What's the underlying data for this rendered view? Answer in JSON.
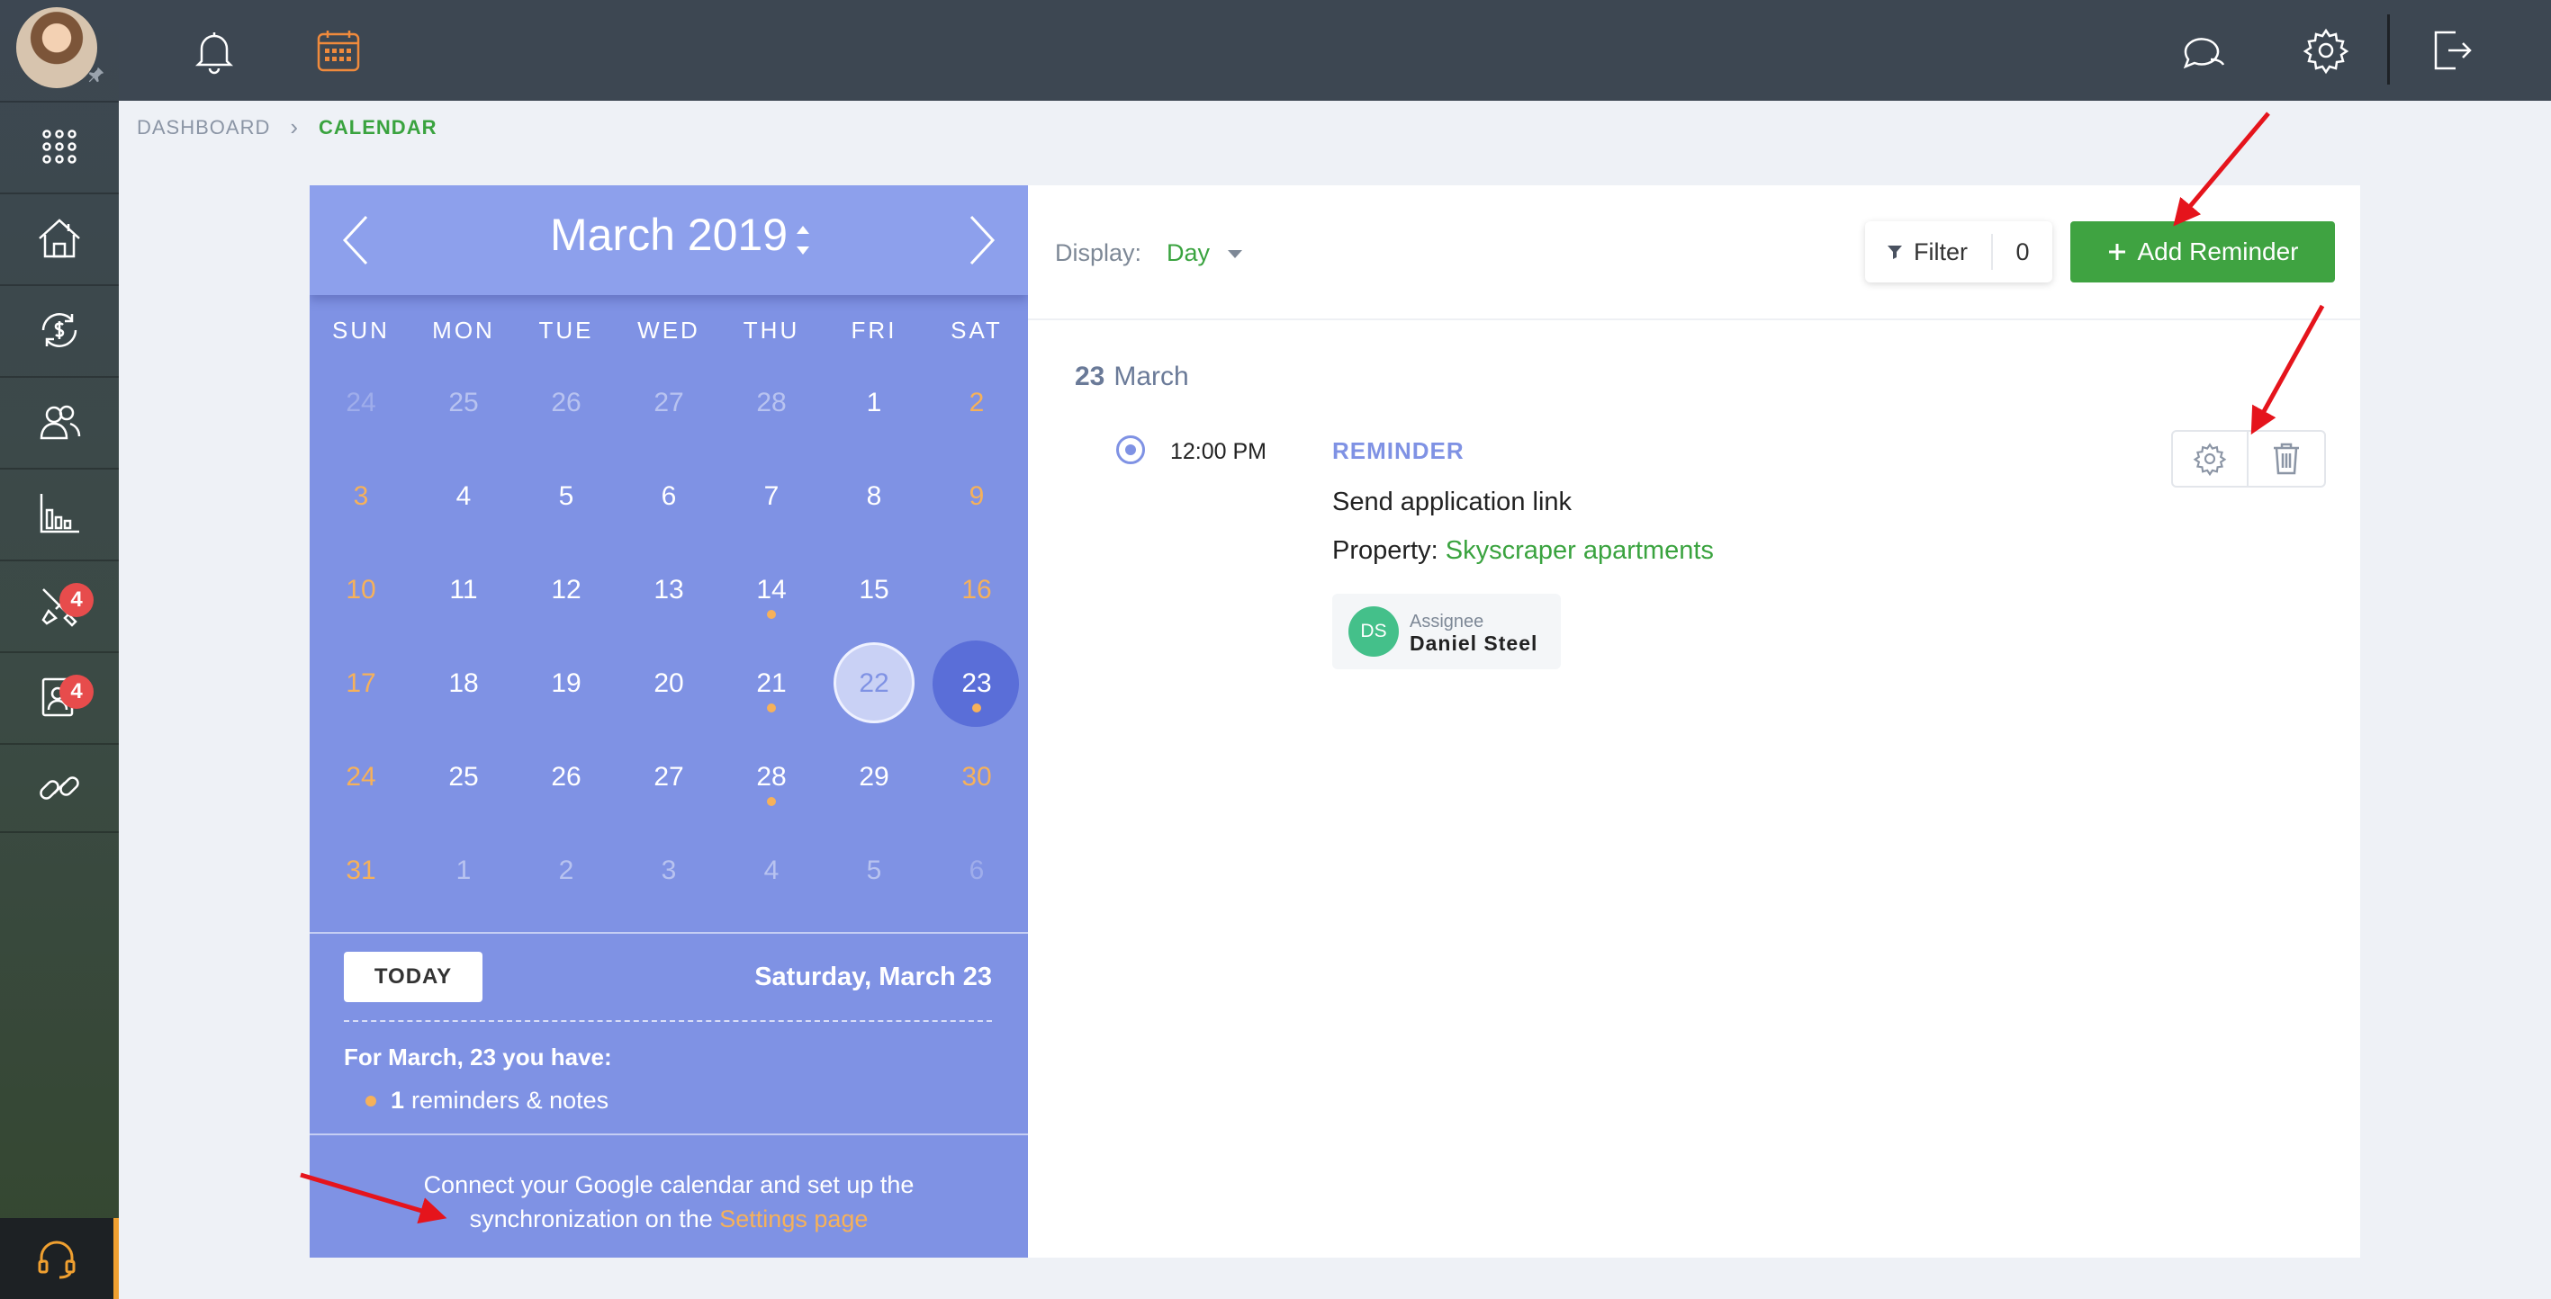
{
  "breadcrumb": {
    "home": "DASHBOARD",
    "separator": "›",
    "current": "CALENDAR"
  },
  "sidebar": {
    "items": [
      {
        "icon": "apps-grid-icon"
      },
      {
        "icon": "properties-icon"
      },
      {
        "icon": "payments-icon"
      },
      {
        "icon": "tenants-icon"
      },
      {
        "icon": "reports-icon"
      },
      {
        "icon": "maintenance-icon",
        "badge": "4"
      },
      {
        "icon": "applicants-icon",
        "badge": "4"
      },
      {
        "icon": "links-icon"
      }
    ]
  },
  "calendar": {
    "title": "March 2019",
    "weekdays": [
      "SUN",
      "MON",
      "TUE",
      "WED",
      "THU",
      "FRI",
      "SAT"
    ],
    "days": [
      {
        "n": "24",
        "m": "very-muted"
      },
      {
        "n": "25",
        "m": "muted"
      },
      {
        "n": "26",
        "m": "muted"
      },
      {
        "n": "27",
        "m": "muted"
      },
      {
        "n": "28",
        "m": "muted"
      },
      {
        "n": "1"
      },
      {
        "n": "2",
        "w": true
      },
      {
        "n": "3",
        "w": true
      },
      {
        "n": "4"
      },
      {
        "n": "5"
      },
      {
        "n": "6"
      },
      {
        "n": "7"
      },
      {
        "n": "8"
      },
      {
        "n": "9",
        "w": true
      },
      {
        "n": "10",
        "w": true
      },
      {
        "n": "11"
      },
      {
        "n": "12"
      },
      {
        "n": "13"
      },
      {
        "n": "14",
        "dot": true
      },
      {
        "n": "15"
      },
      {
        "n": "16",
        "w": true
      },
      {
        "n": "17",
        "w": true
      },
      {
        "n": "18"
      },
      {
        "n": "19"
      },
      {
        "n": "20"
      },
      {
        "n": "21",
        "dot": true
      },
      {
        "n": "22",
        "today": true
      },
      {
        "n": "23",
        "selected": true,
        "dot": true
      },
      {
        "n": "24",
        "w": true
      },
      {
        "n": "25"
      },
      {
        "n": "26"
      },
      {
        "n": "27"
      },
      {
        "n": "28",
        "dot": true
      },
      {
        "n": "29"
      },
      {
        "n": "30",
        "w": true
      },
      {
        "n": "31",
        "w": true
      },
      {
        "n": "1",
        "m": "muted"
      },
      {
        "n": "2",
        "m": "muted"
      },
      {
        "n": "3",
        "m": "muted"
      },
      {
        "n": "4",
        "m": "muted"
      },
      {
        "n": "5",
        "m": "muted"
      },
      {
        "n": "6",
        "m": "very-muted"
      }
    ],
    "today_button": "TODAY",
    "selected_date": "Saturday, March 23",
    "summary_title": "For March, 23 you have:",
    "summary_count": "1",
    "summary_text": "reminders & notes",
    "sync_text": "Connect your Google calendar and set up the synchronization on the",
    "sync_link": "Settings page"
  },
  "panel": {
    "display_label": "Display:",
    "display_value": "Day",
    "filter_label": "Filter",
    "filter_count": "0",
    "add_button": "Add Reminder",
    "date_day": "23",
    "date_month": "March",
    "event": {
      "time": "12:00 PM",
      "type": "REMINDER",
      "description": "Send application link",
      "property_label": "Property:",
      "property_value": "Skyscraper apartments",
      "assignee_initials": "DS",
      "assignee_role": "Assignee",
      "assignee_name": "Daniel Steel"
    }
  },
  "colors": {
    "calendar_bg": "#7f92e4",
    "accent_green": "#3fa341",
    "weekend_orange": "#f6b15a",
    "badge_red": "#e74c4c"
  }
}
